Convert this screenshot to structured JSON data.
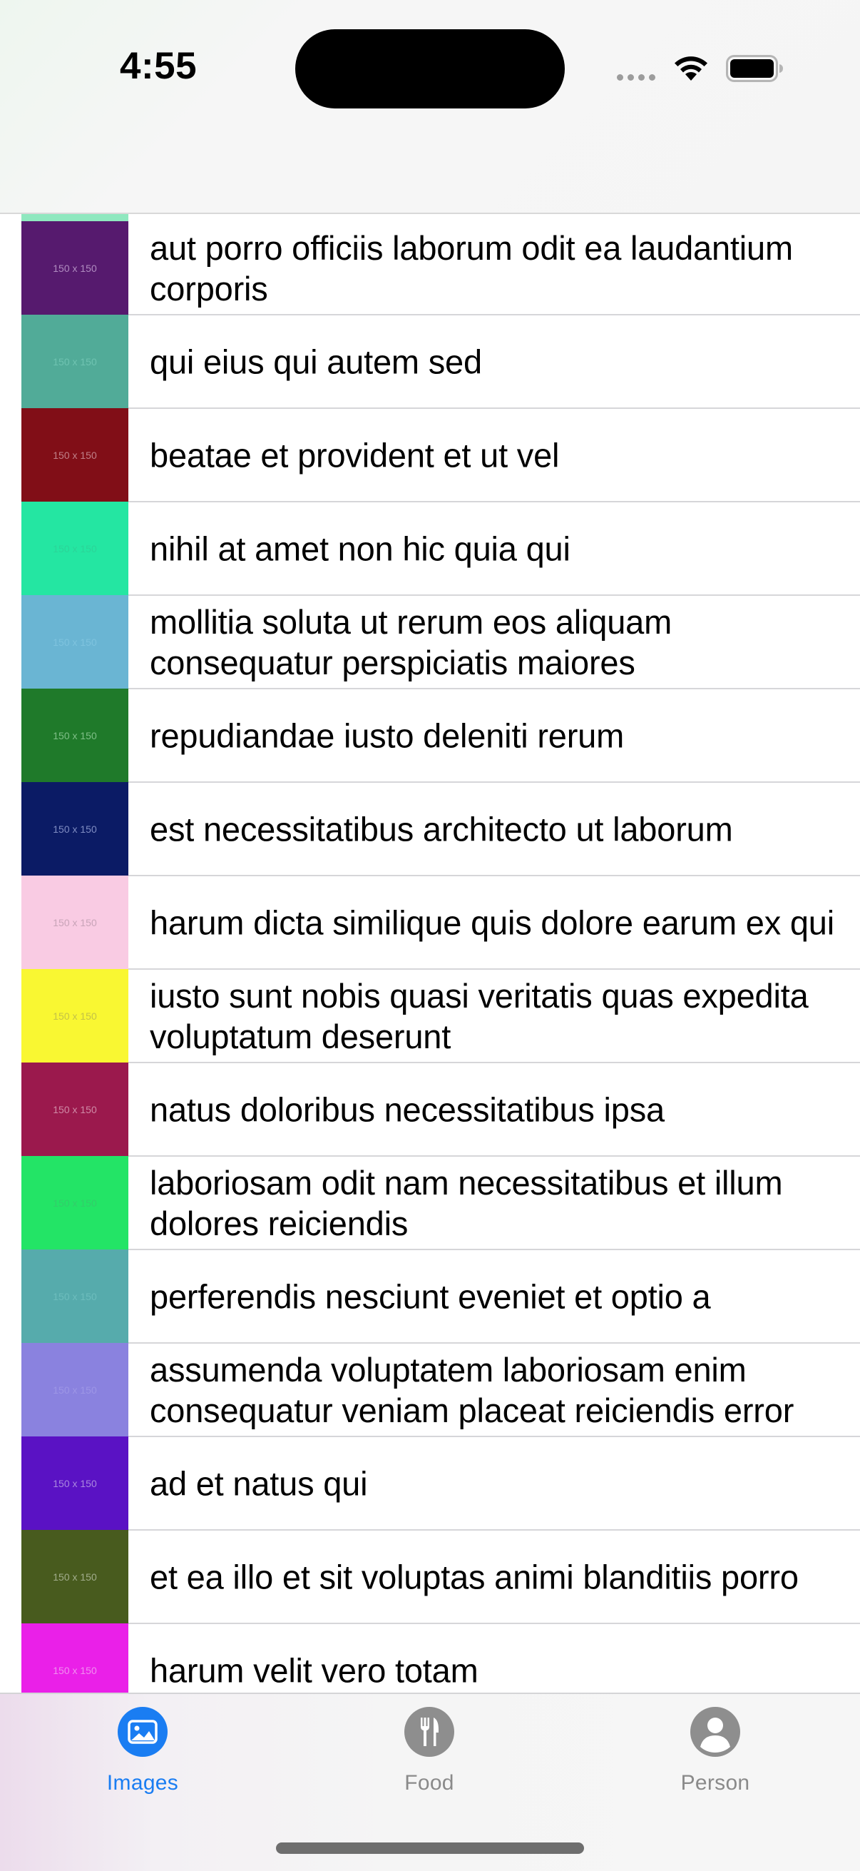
{
  "status_bar": {
    "time": "4:55"
  },
  "list": {
    "items": [
      {
        "title": "aut porro officiis laborum odit ea laudantium corporis",
        "thumb_label": "150 x 150",
        "color": "#561a6e",
        "label_color": "#b08cc0"
      },
      {
        "title": "qui eius qui autem sed",
        "thumb_label": "150 x 150",
        "color": "#51ab98",
        "label_color": "#6fc3b1"
      },
      {
        "title": "beatae et provident et ut vel",
        "thumb_label": "150 x 150",
        "color": "#810e17",
        "label_color": "#c08088"
      },
      {
        "title": "nihil at amet non hic quia qui",
        "thumb_label": "150 x 150",
        "color": "#24e6a2",
        "label_color": "#2bd498"
      },
      {
        "title": "mollitia soluta ut rerum eos aliquam consequatur perspiciatis maiores",
        "thumb_label": "150 x 150",
        "color": "#6ab5d3",
        "label_color": "#7ec3de"
      },
      {
        "title": "repudiandae iusto deleniti rerum",
        "thumb_label": "150 x 150",
        "color": "#1f7a2a",
        "label_color": "#7fbf87"
      },
      {
        "title": "est necessitatibus architecto ut laborum",
        "thumb_label": "150 x 150",
        "color": "#0b1b65",
        "label_color": "#7f8cc2"
      },
      {
        "title": "harum dicta similique quis dolore earum ex qui",
        "thumb_label": "150 x 150",
        "color": "#f9cbe3",
        "label_color": "#c8a4b8"
      },
      {
        "title": "iusto sunt nobis quasi veritatis quas expedita voluptatum deserunt",
        "thumb_label": "150 x 150",
        "color": "#f9f732",
        "label_color": "#c4c247"
      },
      {
        "title": "natus doloribus necessitatibus ipsa",
        "thumb_label": "150 x 150",
        "color": "#9b194d",
        "label_color": "#d08aa6"
      },
      {
        "title": "laboriosam odit nam necessitatibus et illum dolores reiciendis",
        "thumb_label": "150 x 150",
        "color": "#23e466",
        "label_color": "#33cc6a"
      },
      {
        "title": "perferendis nesciunt eveniet et optio a",
        "thumb_label": "150 x 150",
        "color": "#56abac",
        "label_color": "#6dbdbd"
      },
      {
        "title": "assumenda voluptatem laboriosam enim consequatur veniam placeat reiciendis error",
        "thumb_label": "150 x 150",
        "color": "#8a82df",
        "label_color": "#9d96e6"
      },
      {
        "title": "ad et natus qui",
        "thumb_label": "150 x 150",
        "color": "#5a12c4",
        "label_color": "#aa88df"
      },
      {
        "title": "et ea illo et sit voluptas animi blanditiis porro",
        "thumb_label": "150 x 150",
        "color": "#485b1e",
        "label_color": "#a2ad8c"
      },
      {
        "title": "harum velit vero totam",
        "thumb_label": "150 x 150",
        "color": "#ea20e8",
        "label_color": "#f18ef0"
      }
    ]
  },
  "tab_bar": {
    "tabs": [
      {
        "label": "Images",
        "icon": "photo-icon",
        "selected": true
      },
      {
        "label": "Food",
        "icon": "fork-knife-icon",
        "selected": false
      },
      {
        "label": "Person",
        "icon": "person-icon",
        "selected": false
      }
    ],
    "accent_color": "#1a7df2",
    "inactive_color": "#8e8e8e"
  }
}
